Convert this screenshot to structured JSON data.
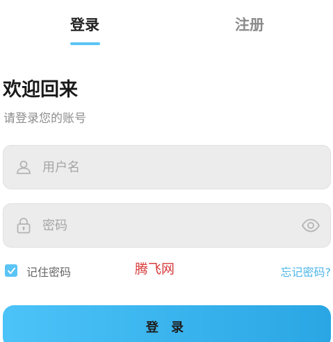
{
  "tabs": {
    "login_label": "登录",
    "register_label": "注册"
  },
  "heading": {
    "title": "欢迎回来",
    "subtitle": "请登录您的账号"
  },
  "form": {
    "username_placeholder": "用户名",
    "password_placeholder": "密码",
    "remember_label": "记住密码",
    "remember_checked": true,
    "forgot_label": "忘记密码?",
    "submit_label": "登 录"
  },
  "watermark": "腾飞网",
  "icons": {
    "user": "user-icon",
    "lock": "lock-icon",
    "eye": "eye-icon",
    "check": "check-icon"
  },
  "colors": {
    "accent": "#5bc4f5",
    "button_start": "#4cc3f8",
    "button_end": "#2aa6e4",
    "field_bg": "#ececec",
    "link": "#4cb6ea",
    "watermark": "#d83a3a"
  }
}
